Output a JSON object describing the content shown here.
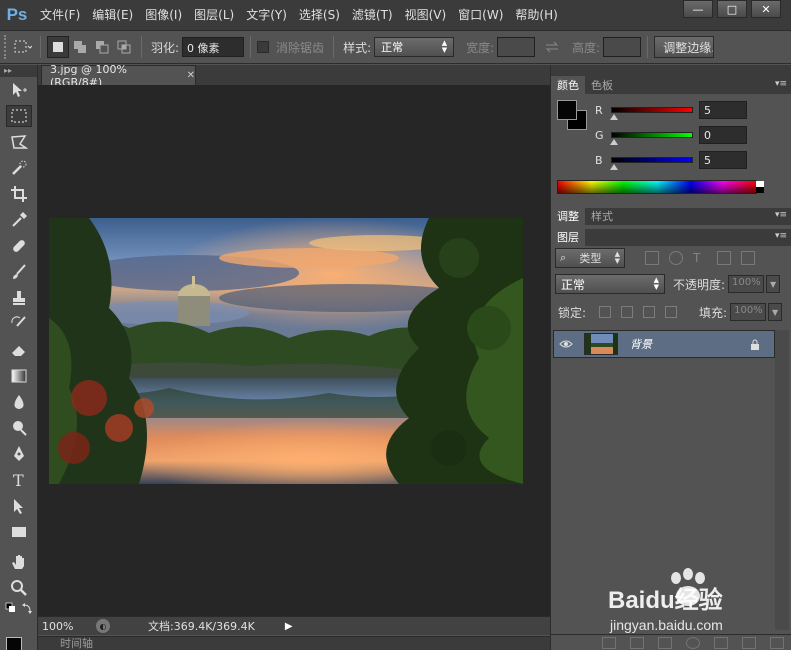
{
  "app": {
    "logo": "Ps"
  },
  "menu": [
    "文件(F)",
    "编辑(E)",
    "图像(I)",
    "图层(L)",
    "文字(Y)",
    "选择(S)",
    "滤镜(T)",
    "视图(V)",
    "窗口(W)",
    "帮助(H)"
  ],
  "window_buttons": {
    "minimize": "—",
    "maximize": "□",
    "close": "✕"
  },
  "options": {
    "feather_label": "羽化:",
    "feather_value": "0 像素",
    "antialias_label": "消除锯齿",
    "style_label": "样式:",
    "style_value": "正常",
    "width_label": "宽度:",
    "height_label": "高度:",
    "refine_edge": "调整边缘..."
  },
  "document": {
    "tab_title": "3.jpg @ 100%(RGB/8#)",
    "tab_close": "✕",
    "zoom": "100%",
    "doc_info": "文档:369.4K/369.4K",
    "timeline": "时间轴"
  },
  "color_panel": {
    "tabs": [
      "颜色",
      "色板"
    ],
    "channels": [
      {
        "label": "R",
        "value": "5",
        "color": "#ff0000"
      },
      {
        "label": "G",
        "value": "0",
        "color": "#00ff00"
      },
      {
        "label": "B",
        "value": "5",
        "color": "#0000ff"
      }
    ]
  },
  "adjust_panel": {
    "tabs": [
      "调整",
      "样式"
    ]
  },
  "layers_panel": {
    "tab": "图层",
    "filter_label": "类型",
    "blend_mode": "正常",
    "opacity_label": "不透明度:",
    "opacity_value": "100%",
    "lock_label": "锁定:",
    "fill_label": "填充:",
    "fill_value": "100%",
    "layers": [
      {
        "name": "背景"
      }
    ]
  },
  "watermark": {
    "brand": "Baidu经验",
    "url": "jingyan.baidu.com"
  },
  "colors": {
    "menubar": "#3b3b3b",
    "panel": "#535353",
    "canvas": "#262626",
    "layer_selected": "#5d6e84"
  }
}
